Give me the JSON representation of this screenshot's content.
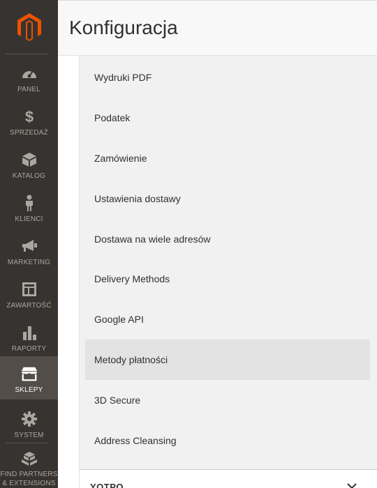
{
  "header": {
    "title": "Konfiguracja"
  },
  "sidebar": {
    "items": [
      {
        "label": "PANEL",
        "icon": "dashboard-icon"
      },
      {
        "label": "SPRZEDAŻ",
        "icon": "dollar-icon"
      },
      {
        "label": "KATALOG",
        "icon": "box-icon"
      },
      {
        "label": "KLIENCI",
        "icon": "person-icon"
      },
      {
        "label": "MARKETING",
        "icon": "megaphone-icon"
      },
      {
        "label": "ZAWARTOŚĆ",
        "icon": "content-icon"
      },
      {
        "label": "RAPORTY",
        "icon": "bar-chart-icon"
      },
      {
        "label": "SKLEPY",
        "icon": "store-icon",
        "active": true
      },
      {
        "label": "SYSTEM",
        "icon": "gear-icon"
      },
      {
        "label": "FIND PARTNERS & EXTENSIONS",
        "icon": "extensions-icon"
      }
    ]
  },
  "config_items": [
    "Wydruki PDF",
    "Podatek",
    "Zamówienie",
    "Ustawienia dostawy",
    "Dostawa na wiele adresów",
    "Delivery Methods",
    "Google API",
    "Metody płatności",
    "3D Secure",
    "Address Cleansing"
  ],
  "active_config_item": "Metody płatności",
  "next_group": {
    "title": "YOTPO"
  },
  "colors": {
    "sidebar_bg": "#373330",
    "sidebar_active": "#524d49",
    "brand_orange": "#eb5202",
    "panel_bg": "#f1f1f1"
  }
}
